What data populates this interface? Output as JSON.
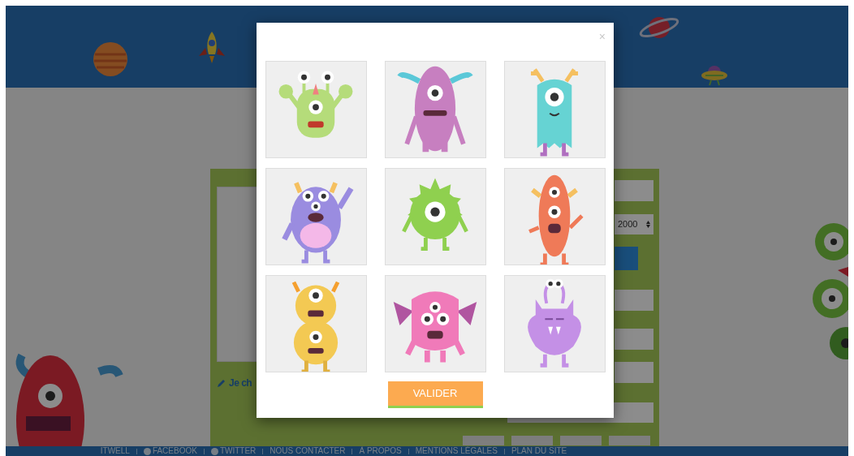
{
  "form": {
    "edit_link": "Je ch",
    "year_select": "2000"
  },
  "footer": {
    "links": [
      "ITWELL",
      "FACEBOOK",
      "TWITTER",
      "NOUS CONTACTER",
      "À PROPOS",
      "MENTIONS LÉGALES",
      "PLAN DU SITE"
    ]
  },
  "modal": {
    "close": "×",
    "monsters": [
      {
        "kind": "three-eyed",
        "color": "#b5dc7a"
      },
      {
        "kind": "horned",
        "color": "#c77fc0"
      },
      {
        "kind": "antlered",
        "color": "#66d3d3"
      },
      {
        "kind": "waving",
        "color": "#9a8ce0"
      },
      {
        "kind": "spiky",
        "color": "#8fd04f"
      },
      {
        "kind": "tall",
        "color": "#ef7a58"
      },
      {
        "kind": "stacked",
        "color": "#f3c953"
      },
      {
        "kind": "winged",
        "color": "#f07ab9"
      },
      {
        "kind": "antennae",
        "color": "#c490e6"
      }
    ],
    "button": "VALIDER"
  }
}
